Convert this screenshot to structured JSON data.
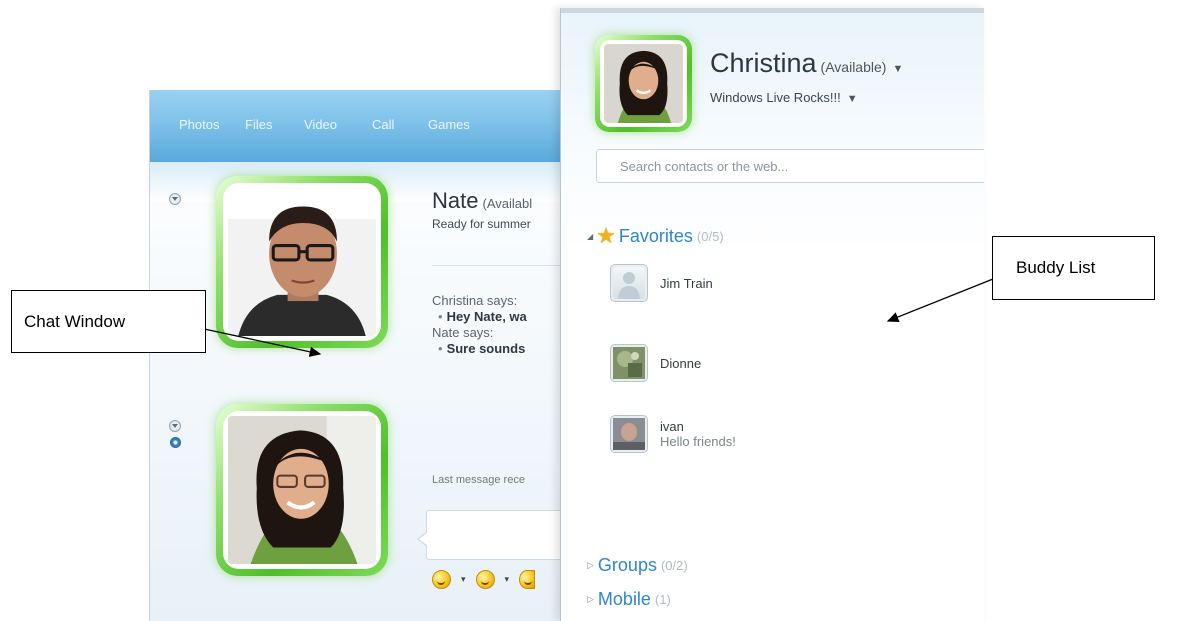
{
  "chat_window": {
    "toolbar": [
      "Photos",
      "Files",
      "Video",
      "Call",
      "Games"
    ],
    "contact": {
      "name": "Nate",
      "status": "(Availabl",
      "personal_message": "Ready for summer"
    },
    "messages": [
      {
        "speaker": "Christina says:",
        "text": "Hey Nate, wa"
      },
      {
        "speaker": "Nate says:",
        "text": "Sure sounds"
      }
    ],
    "last_message": "Last message rece"
  },
  "buddy_list": {
    "me": {
      "name": "Christina",
      "status": "(Available)",
      "personal_message": "Windows Live Rocks!!!"
    },
    "search": {
      "placeholder": "Search contacts or the web..."
    },
    "groups": {
      "favorites": {
        "label": "Favorites",
        "count": "(0/5)"
      },
      "groups": {
        "label": "Groups",
        "count": "(0/2)"
      },
      "mobile": {
        "label": "Mobile",
        "count": "(1)"
      }
    },
    "contacts": [
      {
        "name": "Jim Train",
        "message": ""
      },
      {
        "name": "Dionne",
        "message": ""
      },
      {
        "name": "ivan",
        "message": "Hello friends!"
      }
    ]
  },
  "callouts": {
    "chat_window": "Chat Window",
    "buddy_list": "Buddy List"
  },
  "colors": {
    "toolbar_blue": "#7fc2ea",
    "availability_green": "#4fbf2a",
    "group_header_blue": "#2f86c9"
  }
}
